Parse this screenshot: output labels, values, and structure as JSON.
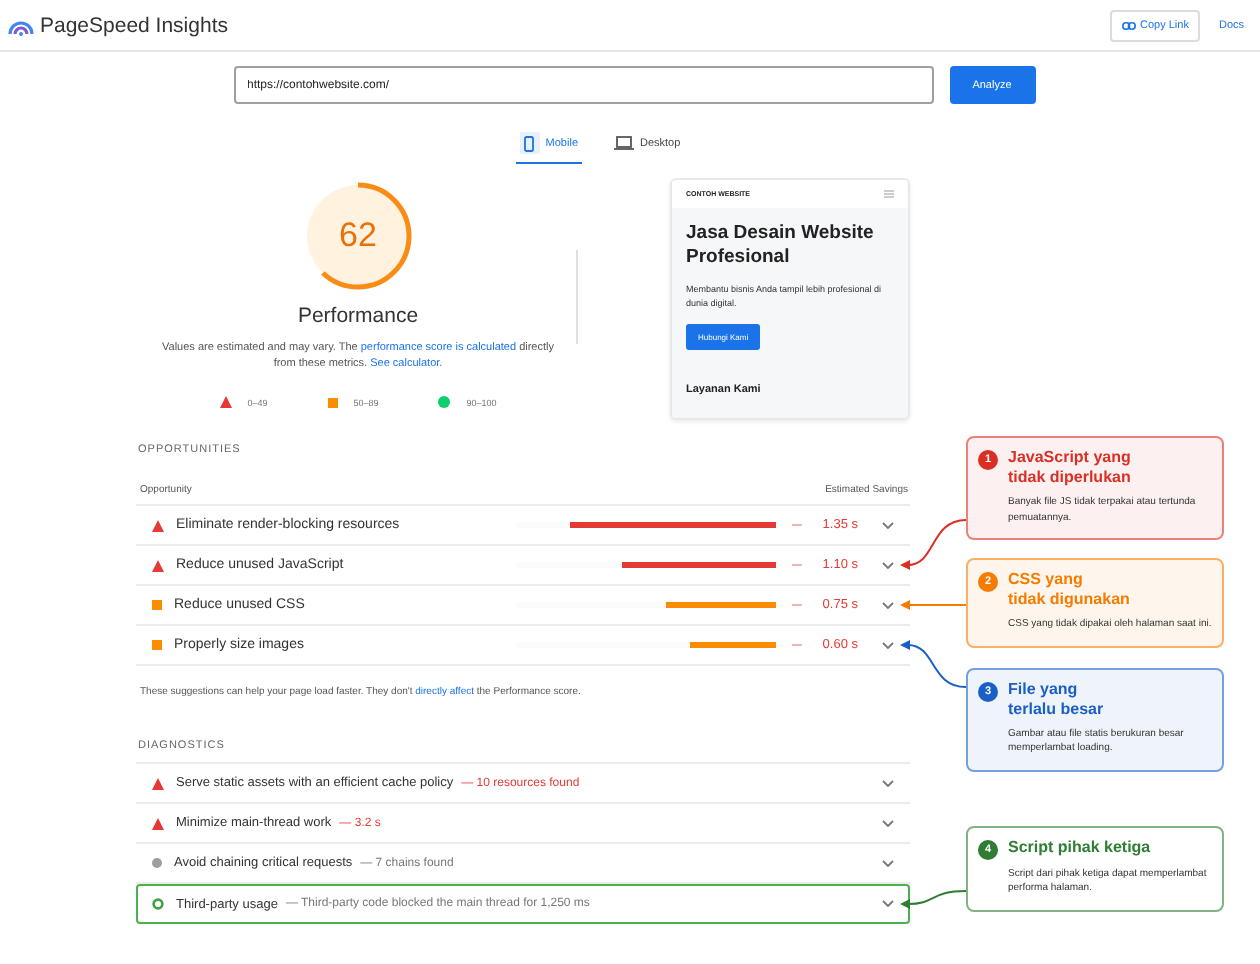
{
  "header": {
    "title": "PageSpeed Insights",
    "copy_link": "Copy Link",
    "docs": "Docs"
  },
  "search": {
    "value": "https://contohwebsite.com/",
    "button": "Analyze"
  },
  "device_tabs": [
    {
      "label": "Mobile",
      "kind": "mobile",
      "selected": true
    },
    {
      "label": "Desktop",
      "kind": "desktop",
      "selected": false
    }
  ],
  "score": {
    "value": "62",
    "level": 0.62,
    "label": "Performance",
    "note": [
      {
        "kind": "text",
        "text": "Values are estimated and may vary. The"
      },
      {
        "kind": "link",
        "text": "performance score is calculated"
      },
      {
        "kind": "text",
        "text": "directly from these metrics."
      },
      {
        "kind": "link",
        "text": "See calculator."
      }
    ],
    "legend": [
      {
        "kind": "fail",
        "label": "0–49"
      },
      {
        "kind": "average",
        "label": "50–89"
      },
      {
        "kind": "pass",
        "label": "90–100"
      }
    ]
  },
  "preview": {
    "brand": "CONTOH WEBSITE",
    "heading": "Jasa Desain Website Profesional",
    "text": "Membantu bisnis Anda tampil lebih profesional di dunia digital.",
    "button": "Hubungi Kami",
    "section_title": "Layanan Kami"
  },
  "opportunities": {
    "title": "OPPORTUNITIES",
    "columns": [
      "Opportunity",
      "Estimated Savings"
    ],
    "rows": [
      {
        "kind": "fail",
        "title": "Eliminate render-blocking resources",
        "savings": "1.35 s",
        "level": 0.79,
        "annotated": false
      },
      {
        "kind": "fail",
        "title": "Reduce unused JavaScript",
        "savings": "1.10 s",
        "level": 0.59,
        "annotated": true
      },
      {
        "kind": "average",
        "title": "Reduce unused CSS",
        "savings": "0.75 s",
        "level": 0.42,
        "annotated": true
      },
      {
        "kind": "average",
        "title": "Properly size images",
        "savings": "0.60 s",
        "level": 0.33,
        "annotated": true
      }
    ],
    "note": [
      {
        "kind": "text",
        "text": "These suggestions can help your page load faster. They don't"
      },
      {
        "kind": "link",
        "text": "directly affect"
      },
      {
        "kind": "text",
        "text": "the Performance score."
      }
    ]
  },
  "diagnostics": {
    "title": "DIAGNOSTICS",
    "rows": [
      {
        "kind": "fail",
        "title": "Serve static assets with an efficient cache policy",
        "detail": "— 10 resources found",
        "highlighted": false,
        "annotated": false
      },
      {
        "kind": "fail",
        "title": "Minimize main-thread work",
        "detail": "— 3.2 s",
        "highlighted": false,
        "annotated": false
      },
      {
        "kind": "info",
        "title": "Avoid chaining critical requests",
        "detail": "— 7 chains found",
        "highlighted": false,
        "annotated": false
      },
      {
        "kind": "notice",
        "title": "Third-party usage",
        "detail": "— Third-party code blocked the main thread for 1,250 ms",
        "highlighted": true,
        "annotated": true
      }
    ]
  },
  "callouts": [
    {
      "number": "1",
      "title": "JavaScript yang\ntidak diperlukan",
      "text": "Banyak file JS tidak terpakai atau tertunda pemuatannya.",
      "color": "#d93025"
    },
    {
      "number": "2",
      "title": "CSS yang\ntidak digunakan",
      "text": "CSS yang tidak dipakai oleh halaman saat ini.",
      "color": "#f57c00"
    },
    {
      "number": "3",
      "title": "File yang\nterlalu besar",
      "text": "Gambar atau file statis berukuran besar memperlambat loading.",
      "color": "#1a5fc8"
    },
    {
      "number": "4",
      "title": "Script pihak ketiga",
      "text": "Script dari pihak ketiga dapat memperlambat performa halaman.",
      "color": "#2e7d32"
    }
  ]
}
